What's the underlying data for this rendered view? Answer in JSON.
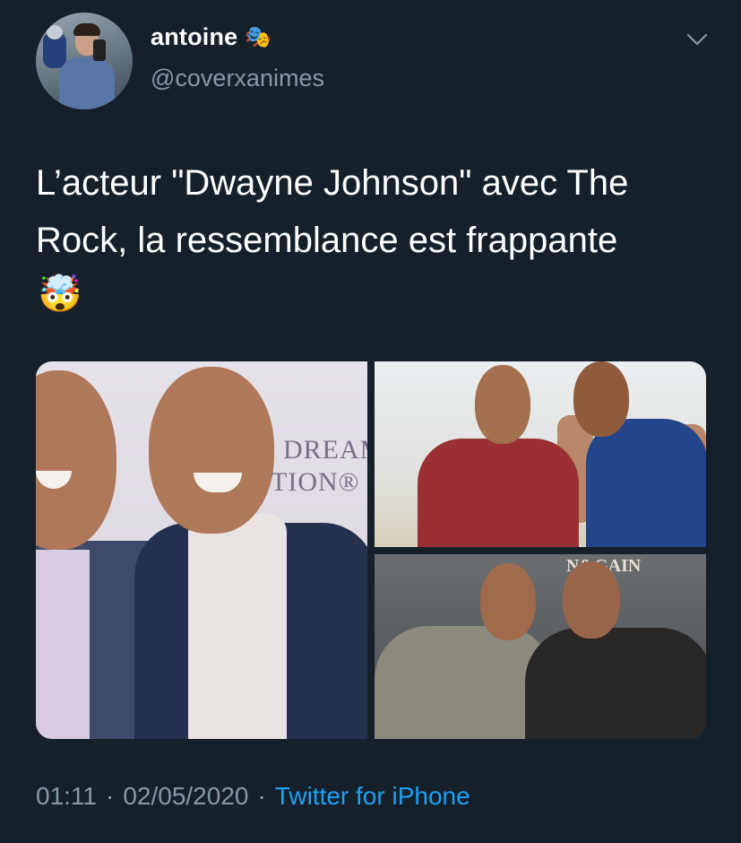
{
  "user": {
    "display_name": "antoine",
    "name_emoji": "🎭",
    "handle": "@coverxanimes"
  },
  "tweet": {
    "text": "L’acteur \"Dwayne Johnson\" avec The Rock, la ressemblance est frappante",
    "emoji": "🤯"
  },
  "media": {
    "image_1_sign": [
      "DREAM",
      "TION®"
    ],
    "image_3_sign": "N&GAIN"
  },
  "meta": {
    "time": "01:11",
    "separator_1": "·",
    "date": "02/05/2020",
    "separator_2": "·",
    "source": "Twitter for iPhone"
  },
  "icons": {
    "menu": "chevron-down-icon"
  },
  "colors": {
    "background": "#15202b",
    "secondary_text": "#8899a6",
    "link": "#1da1f2"
  }
}
